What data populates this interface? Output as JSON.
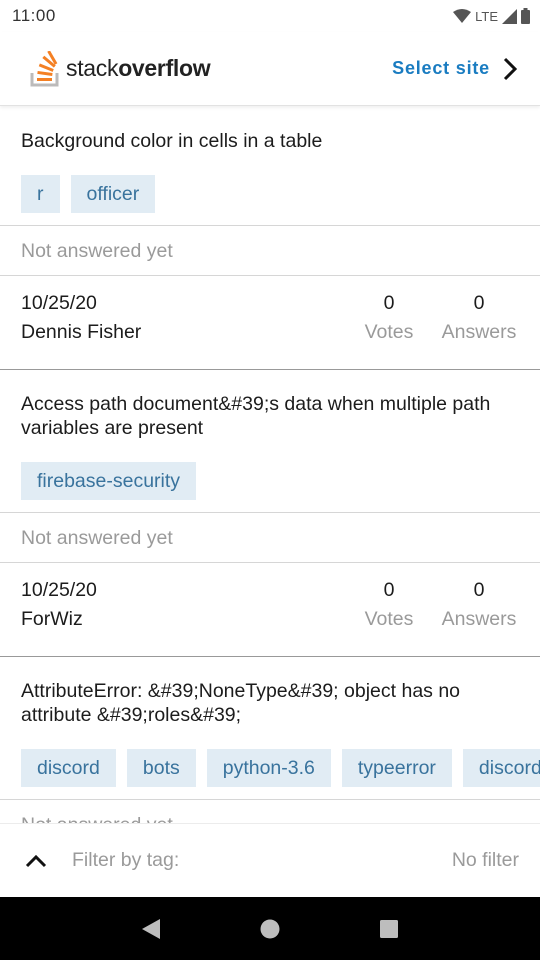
{
  "status_bar": {
    "time": "11:00",
    "network": "LTE"
  },
  "header": {
    "logo_text_regular": "stack",
    "logo_text_bold": "overflow",
    "select_site_label": "Select site"
  },
  "questions": [
    {
      "title": "Background color in cells in a table",
      "tags": [
        "r",
        "officer"
      ],
      "status": "Not answered yet",
      "date": "10/25/20",
      "author": "Dennis Fisher",
      "votes": "0",
      "votes_label": "Votes",
      "answers": "0",
      "answers_label": "Answers"
    },
    {
      "title": "Access path document&#39;s data when multiple path variables are present",
      "tags": [
        "firebase-security"
      ],
      "status": "Not answered yet",
      "date": "10/25/20",
      "author": "ForWiz",
      "votes": "0",
      "votes_label": "Votes",
      "answers": "0",
      "answers_label": "Answers"
    },
    {
      "title": "AttributeError: &#39;NoneType&#39; object has no attribute &#39;roles&#39;",
      "tags": [
        "discord",
        "bots",
        "python-3.6",
        "typeerror",
        "discord.py"
      ],
      "status": "Not answered yet"
    }
  ],
  "filter_bar": {
    "label": "Filter by tag:",
    "value": "No filter"
  },
  "colors": {
    "accent": "#1a7cc1",
    "tag_bg": "#e1ecf4",
    "tag_text": "#39739d",
    "logo_orange": "#f48024"
  }
}
